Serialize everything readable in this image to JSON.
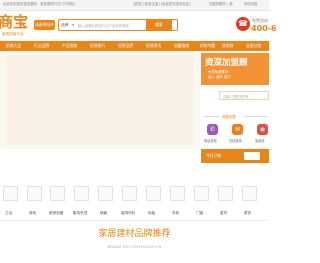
{
  "topbar": {
    "left_text": "欢迎来到招商宝加盟网，家居建材行业门户网站！",
    "center_text": "[登录] [免费注册] [免费发布招商信息]",
    "right_text": "加盟商服务 | 我",
    "right_link": "网站导航"
  },
  "header": {
    "logo_text": "商宝",
    "logo_sub": "家居招商平台",
    "city_label": "请选择城市",
    "search_category": "品牌",
    "search_placeholder": "输入品牌名称或行业产品名称搜索",
    "search_button": "搜索",
    "hotline_label": "免费咨询",
    "hotline_number": "400-6"
  },
  "nav": {
    "items": [
      "招商大全",
      "行业品牌",
      "产品招商",
      "招商排行",
      "优质品牌",
      "招商资讯",
      "加盟指南",
      "招商专题",
      "经销商",
      "全部分类"
    ]
  },
  "sidebar": {
    "banner_title": "资深加盟顾",
    "banner_sub": "为您免费推荐",
    "banner_sub2": "省心 省时 省力",
    "input_placeholder": "请输入您的手机号",
    "join_text": "我要加盟",
    "icons": [
      {
        "icon": "phone-icon",
        "label": "电话咨询",
        "color": "#9b59b6"
      },
      {
        "icon": "chat-icon",
        "label": "在线咨询",
        "color": "#e67e22"
      },
      {
        "icon": "camera-icon",
        "label": "免费送",
        "color": "#e74c3c"
      }
    ],
    "banner2_text": "今日已有"
  },
  "categories": [
    {
      "label": "卫浴",
      "icon": "bathroom-icon"
    },
    {
      "label": "瓷砖",
      "icon": "tile-icon"
    },
    {
      "label": "厨房电器",
      "icon": "kitchen-icon"
    },
    {
      "label": "集成吊顶",
      "icon": "ceiling-icon"
    },
    {
      "label": "墙面",
      "icon": "wall-icon"
    },
    {
      "label": "装饰材料",
      "icon": "material-icon"
    },
    {
      "label": "地板",
      "icon": "floor-icon"
    },
    {
      "label": "衣柜",
      "icon": "wardrobe-icon"
    },
    {
      "label": "门窗",
      "icon": "door-icon"
    },
    {
      "label": "窗帘",
      "icon": "curtain-icon"
    },
    {
      "label": "更多",
      "icon": "more-icon"
    }
  ],
  "section": {
    "title": "家居建材品牌推荐",
    "subtitle": "BRAND RECOMMENDATION"
  }
}
